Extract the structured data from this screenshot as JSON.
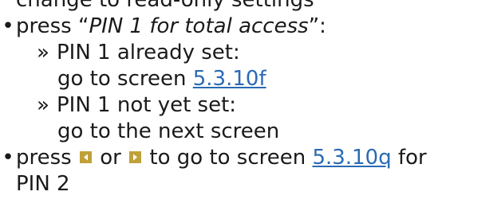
{
  "lines": {
    "top_cut": "change to read-only settings",
    "press": "press",
    "pin1_quote_open": "“",
    "pin1_option": "PIN 1 for total access",
    "pin1_quote_close": "”:",
    "sub_marker": "»",
    "pin1_set": "PIN 1 already set:",
    "goto_screen": "go to screen",
    "link_5_3_10f": "5.3.10f",
    "pin1_not_set": "PIN 1 not yet set:",
    "goto_next": "go to the next screen",
    "press2": "press",
    "or": "or",
    "to_goto": "to go to screen",
    "link_5_3_10q": "5.3.10q",
    "for": "for",
    "pin2": "PIN 2"
  },
  "icons": {
    "left": "arrow-left-button-icon",
    "right": "arrow-right-button-icon"
  },
  "colors": {
    "link": "#2a6ab4",
    "button": "#bfa13a"
  }
}
